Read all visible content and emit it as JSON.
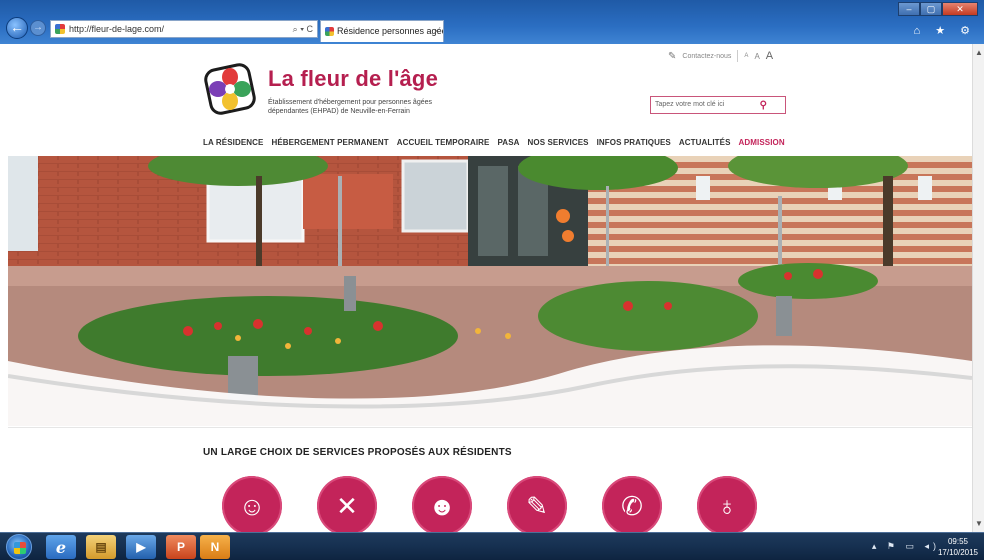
{
  "browser": {
    "url": "http://fleur-de-lage.com/",
    "address_tools": "⌕ ▾ C",
    "tab_title": "Résidence personnes agées ...",
    "tab_close": "×",
    "window_buttons": {
      "minimize": "–",
      "maximize": "▢",
      "close": "✕"
    },
    "toolbar_icons": "⌂ ★ ⚙"
  },
  "site": {
    "title": "La fleur de l'âge",
    "subtitle": "Établissement d'hébergement pour personnes âgées dépendantes (EHPAD) de Neuville-en-Ferrain",
    "contact_label": "Contactez-nous",
    "font_sizes": [
      "A",
      "A",
      "A"
    ],
    "search_placeholder": "Tapez votre mot clé ici"
  },
  "menu": [
    {
      "label": "LA RÉSIDENCE",
      "active": false
    },
    {
      "label": "HÉBERGEMENT PERMANENT",
      "active": false
    },
    {
      "label": "ACCUEIL TEMPORAIRE",
      "active": false
    },
    {
      "label": "PASA",
      "active": false
    },
    {
      "label": "NOS SERVICES",
      "active": false
    },
    {
      "label": "INFOS PRATIQUES",
      "active": false
    },
    {
      "label": "ACTUALITÉS",
      "active": false
    },
    {
      "label": "ADMISSION",
      "active": true
    }
  ],
  "section": {
    "title": "UN LARGE CHOIX DE SERVICES PROPOSÉS AUX RÉSIDENTS"
  },
  "services": [
    {
      "icon": "hairdresser-icon",
      "glyph": "☺"
    },
    {
      "icon": "restaurant-icon",
      "glyph": "✕"
    },
    {
      "icon": "theater-masks-icon",
      "glyph": "☻"
    },
    {
      "icon": "cleaning-brush-icon",
      "glyph": "✎"
    },
    {
      "icon": "phone-icon",
      "glyph": "✆"
    },
    {
      "icon": "stethoscope-icon",
      "glyph": "♁"
    }
  ],
  "taskbar": {
    "ie_glyph": "e",
    "folder_glyph": "▤",
    "media_glyph": "▶",
    "ppt_glyph": "P",
    "note_glyph": "N",
    "tray_icons": "▴ ⚑ ▭ ◂)",
    "time": "09:55",
    "date": "17/10/2015"
  },
  "colors": {
    "brand": "#c3245a",
    "chrome": "#2b6ec2",
    "taskbar": "#163050"
  }
}
